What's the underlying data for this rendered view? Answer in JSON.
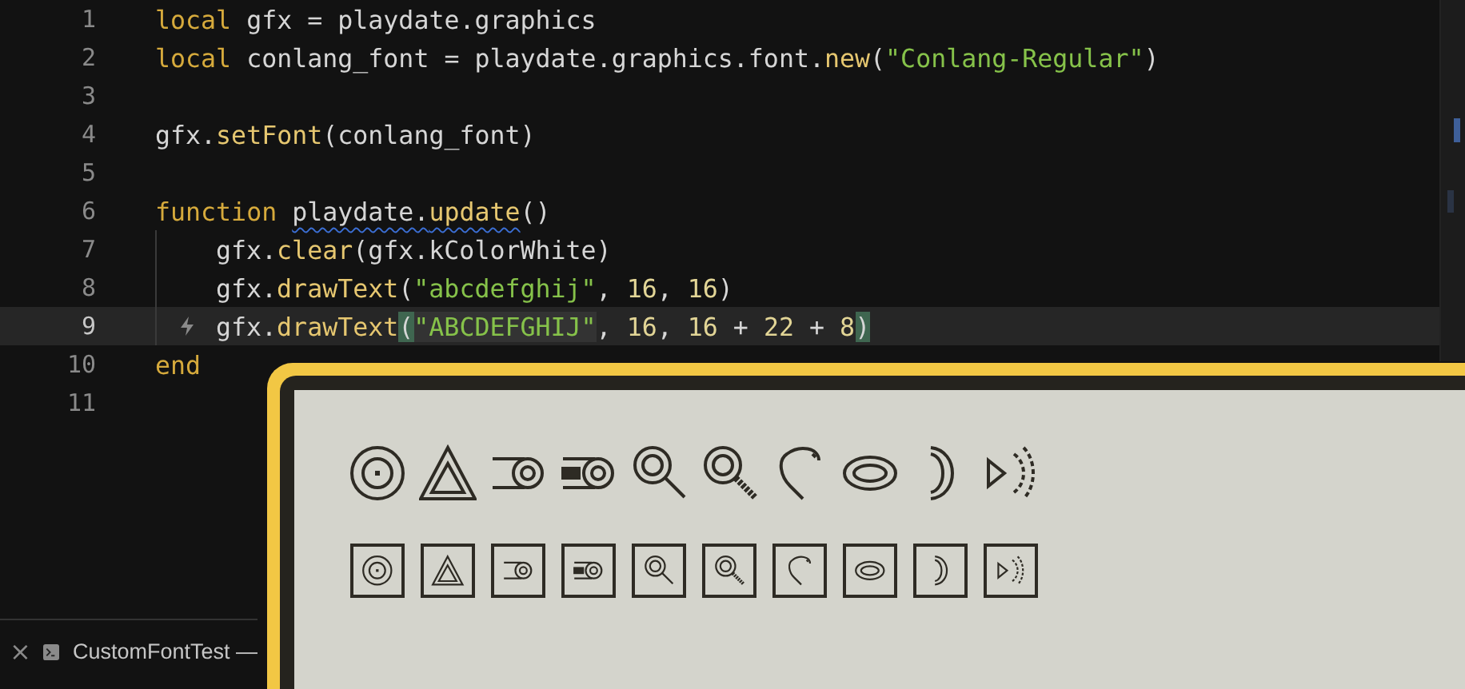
{
  "editor": {
    "lines": [
      {
        "number": "1",
        "current": false,
        "indented": false,
        "tokens": [
          {
            "kind": "keyword",
            "text": "local"
          },
          {
            "kind": "plain",
            "text": " gfx = playdate.graphics"
          }
        ]
      },
      {
        "number": "2",
        "current": false,
        "indented": false,
        "tokens": [
          {
            "kind": "keyword",
            "text": "local"
          },
          {
            "kind": "plain",
            "text": " conlang_font = playdate.graphics.font."
          },
          {
            "kind": "function",
            "text": "new"
          },
          {
            "kind": "plain",
            "text": "("
          },
          {
            "kind": "string",
            "text": "\"Conlang-Regular\""
          },
          {
            "kind": "plain",
            "text": ")"
          }
        ]
      },
      {
        "number": "3",
        "current": false,
        "indented": false
      },
      {
        "number": "4",
        "current": false,
        "indented": false,
        "tokens": [
          {
            "kind": "plain",
            "text": "gfx."
          },
          {
            "kind": "function",
            "text": "setFont"
          },
          {
            "kind": "plain",
            "text": "(conlang_font)"
          }
        ]
      },
      {
        "number": "5",
        "current": false,
        "indented": false
      },
      {
        "number": "6",
        "current": false,
        "indented": false,
        "tokens": [
          {
            "kind": "keyword",
            "text": "function "
          },
          {
            "kind": "plain",
            "text": "playdate.",
            "underlined": true
          },
          {
            "kind": "function",
            "text": "update",
            "underlined": true
          },
          {
            "kind": "plain",
            "text": "()"
          }
        ]
      },
      {
        "number": "7",
        "current": false,
        "indented": true,
        "tokens": [
          {
            "kind": "plain",
            "text": "gfx."
          },
          {
            "kind": "function",
            "text": "clear"
          },
          {
            "kind": "plain",
            "text": "(gfx.kColorWhite)"
          }
        ]
      },
      {
        "number": "8",
        "current": false,
        "indented": true,
        "tokens": [
          {
            "kind": "plain",
            "text": "gfx."
          },
          {
            "kind": "function",
            "text": "drawText"
          },
          {
            "kind": "plain",
            "text": "("
          },
          {
            "kind": "string",
            "text": "\"abcdefghij\""
          },
          {
            "kind": "plain",
            "text": ", "
          },
          {
            "kind": "number",
            "text": "16"
          },
          {
            "kind": "plain",
            "text": ", "
          },
          {
            "kind": "number",
            "text": "16"
          },
          {
            "kind": "plain",
            "text": ")"
          }
        ]
      },
      {
        "number": "9",
        "current": true,
        "indented": true,
        "tokens": [
          {
            "kind": "plain",
            "text": "gfx."
          },
          {
            "kind": "function",
            "text": "drawText"
          },
          {
            "kind": "plain",
            "text": "(",
            "bracket_match": true
          },
          {
            "kind": "string",
            "text": "\"ABCDEFGHIJ\"",
            "highlighted": true
          },
          {
            "kind": "plain",
            "text": ", "
          },
          {
            "kind": "number",
            "text": "16"
          },
          {
            "kind": "plain",
            "text": ", "
          },
          {
            "kind": "number",
            "text": "16"
          },
          {
            "kind": "plain",
            "text": " + "
          },
          {
            "kind": "number",
            "text": "22"
          },
          {
            "kind": "plain",
            "text": " + "
          },
          {
            "kind": "number",
            "text": "8"
          },
          {
            "kind": "plain",
            "text": ")",
            "bracket_match": true
          }
        ]
      },
      {
        "number": "10",
        "current": false,
        "indented": false,
        "tokens": [
          {
            "kind": "keyword",
            "text": "end"
          }
        ]
      },
      {
        "number": "11",
        "current": false,
        "indented": false
      }
    ]
  },
  "terminal_tab": {
    "close": "×",
    "title": "CustomFontTest —"
  },
  "simulator": {
    "rows": [
      {
        "framed": false
      },
      {
        "framed": true
      }
    ],
    "glyphs": [
      {
        "kind": "target"
      },
      {
        "kind": "triangle"
      },
      {
        "kind": "bar-circle"
      },
      {
        "kind": "thick-bar-circle"
      },
      {
        "kind": "magnifier"
      },
      {
        "kind": "hatched-magnifier"
      },
      {
        "kind": "hook"
      },
      {
        "kind": "ellipse"
      },
      {
        "kind": "crescent"
      },
      {
        "kind": "speaker"
      }
    ]
  }
}
